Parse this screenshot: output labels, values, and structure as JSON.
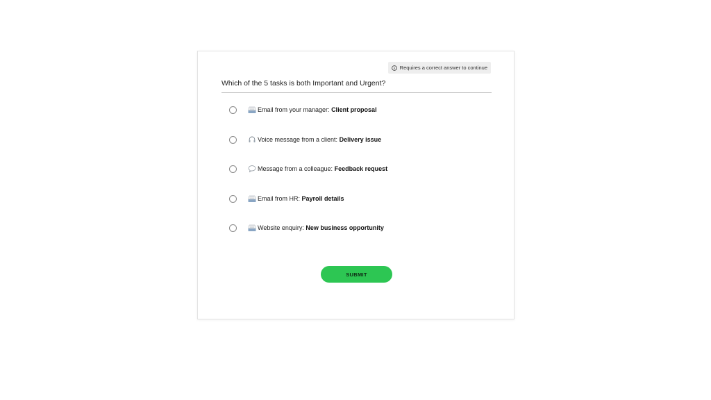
{
  "notice": {
    "icon": "info-circle-icon",
    "text": "Requires a correct answer to continue"
  },
  "question": "Which of the 5 tasks is both Important and Urgent?",
  "options": [
    {
      "icon": "email-tray-icon",
      "prefix": "Email from your manager:",
      "bold": "Client proposal"
    },
    {
      "icon": "headphones-icon",
      "prefix": "Voice message from a client:",
      "bold": "Delivery issue"
    },
    {
      "icon": "speech-bubble-icon",
      "prefix": "Message from a colleague:",
      "bold": "Feedback request"
    },
    {
      "icon": "email-tray-icon",
      "prefix": "Email from HR:",
      "bold": "Payroll details"
    },
    {
      "icon": "email-tray-icon",
      "prefix": "Website enquiry:",
      "bold": "New business opportunity"
    }
  ],
  "submit_label": "SUBMIT",
  "colors": {
    "submit": "#2dc653",
    "notice_bg": "#eeeeee",
    "divider": "#bdbdbd"
  }
}
